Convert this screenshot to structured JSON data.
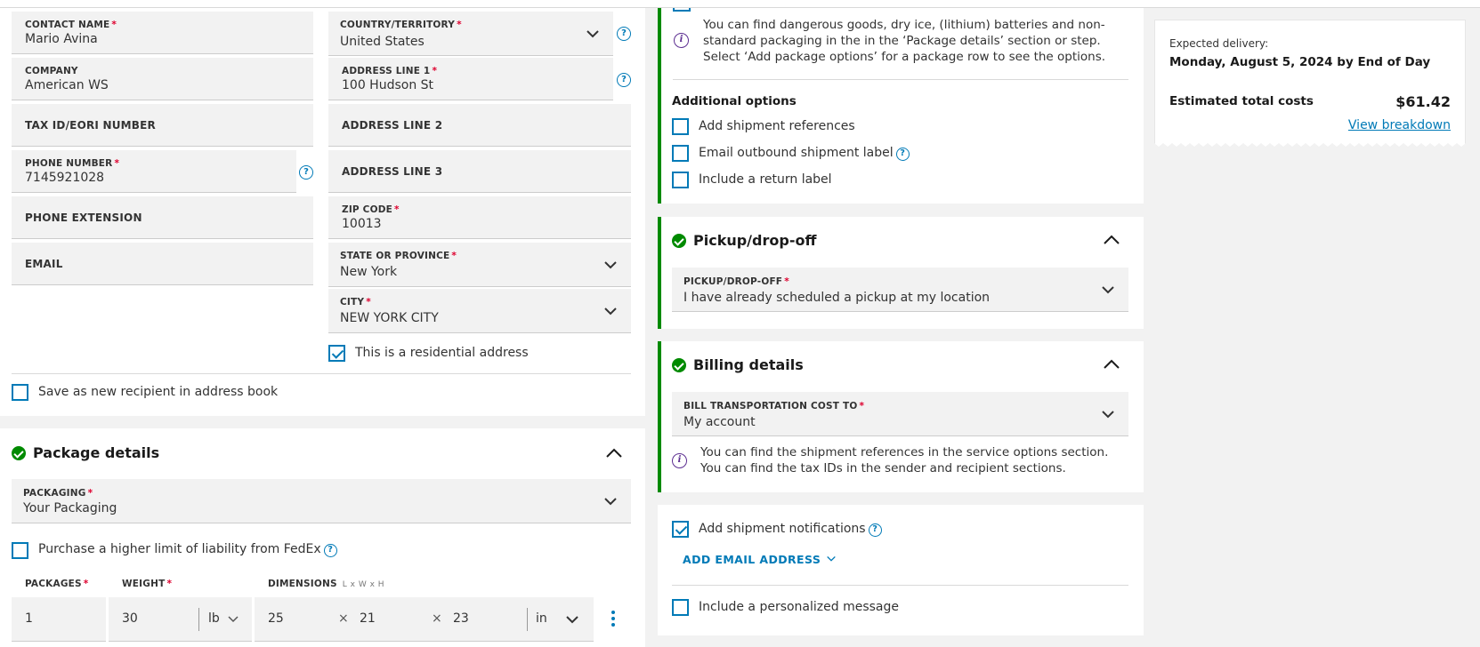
{
  "recipient": {
    "contact_name": {
      "label": "CONTACT NAME",
      "value": "Mario Avina"
    },
    "company": {
      "label": "COMPANY",
      "value": "American WS"
    },
    "tax_id": {
      "label": "TAX ID/EORI NUMBER"
    },
    "phone_number": {
      "label": "PHONE NUMBER",
      "value": "7145921028"
    },
    "phone_extension": {
      "label": "PHONE EXTENSION"
    },
    "email": {
      "label": "EMAIL"
    },
    "country": {
      "label": "COUNTRY/TERRITORY",
      "value": "United States"
    },
    "address_line_1": {
      "label": "ADDRESS LINE 1",
      "value": "100 Hudson St"
    },
    "address_line_2": {
      "label": "ADDRESS LINE 2"
    },
    "address_line_3": {
      "label": "ADDRESS LINE 3"
    },
    "zip_code": {
      "label": "ZIP CODE",
      "value": "10013"
    },
    "state": {
      "label": "STATE OR PROVINCE",
      "value": "New York"
    },
    "city": {
      "label": "CITY",
      "value": "NEW YORK CITY"
    },
    "residential_label": "This is a residential address",
    "save_recipient_label": "Save as new recipient in address book",
    "required_mark": "*",
    "help_glyph": "?"
  },
  "package_details": {
    "title": "Package details",
    "packaging": {
      "label": "PACKAGING",
      "value": "Your Packaging"
    },
    "liability_label": "Purchase a higher limit of liability from FedEx",
    "packages_label": "PACKAGES",
    "weight_label": "WEIGHT",
    "dimensions_label": "DIMENSIONS",
    "dimensions_hint": "L x W x H",
    "packages_value": "1",
    "weight_value": "30",
    "weight_unit": "lb",
    "dim_l": "25",
    "dim_w": "21",
    "dim_h": "23",
    "dim_unit": "in",
    "times": "×"
  },
  "service_options": {
    "info_text": "You can find dangerous goods, dry ice, (lithium) batteries and non-standard packaging in the in the ‘Package details’ section or step. Select ‘Add package options’ for a package row to see the options.",
    "additional_title": "Additional options",
    "add_references": "Add shipment references",
    "email_label": "Email outbound shipment label",
    "return_label": "Include a return label"
  },
  "pickup": {
    "title": "Pickup/drop-off",
    "field_label": "PICKUP/DROP-OFF",
    "field_value": "I have already scheduled a pickup at my location"
  },
  "billing": {
    "title": "Billing details",
    "field_label": "BILL TRANSPORTATION COST TO",
    "field_value": "My account",
    "info_text": "You can find the shipment references in the service options section. You can find the tax IDs in the sender and recipient sections."
  },
  "notifications": {
    "add_notifications": "Add shipment notifications",
    "add_email": "ADD EMAIL ADDRESS",
    "personal_message": "Include a personalized message"
  },
  "summary": {
    "expected_label": "Expected delivery:",
    "expected_value": "Monday, August 5, 2024 by End of Day",
    "total_label": "Estimated total costs",
    "total_value": "$61.42",
    "breakdown_link": "View breakdown"
  },
  "colors": {
    "accent": "#007ab7",
    "success": "#008a00",
    "required": "#de002e",
    "info": "#5c2e91"
  }
}
